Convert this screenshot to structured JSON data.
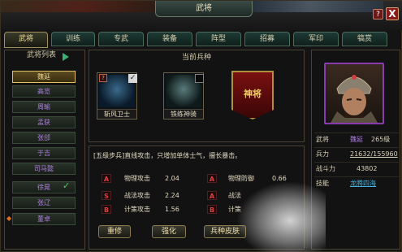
{
  "window": {
    "title": "武将",
    "help": "?",
    "close": "X"
  },
  "tabs": [
    {
      "label": "武将"
    },
    {
      "label": "训练"
    },
    {
      "label": "专武"
    },
    {
      "label": "装备"
    },
    {
      "label": "阵型"
    },
    {
      "label": "招募"
    },
    {
      "label": "军印"
    },
    {
      "label": "犒赏"
    }
  ],
  "general_list": {
    "title": "武将列表",
    "items": [
      {
        "label": "魏延"
      },
      {
        "label": "高览"
      },
      {
        "label": "周瑜"
      },
      {
        "label": "孟获"
      },
      {
        "label": "张郃"
      },
      {
        "label": "于吉"
      },
      {
        "label": "司马懿"
      },
      {
        "label": "徐晃"
      },
      {
        "label": "张辽"
      },
      {
        "label": "董卓"
      }
    ]
  },
  "troops": {
    "title": "当前兵种",
    "cards": [
      {
        "label": "斩风卫士"
      },
      {
        "label": "铁练神骑"
      }
    ],
    "banner_text": "神将"
  },
  "description": "[五级步兵]直线攻击，只增加单体士气，擅长暴击。",
  "stats": {
    "left": [
      {
        "icon": "A",
        "name": "物理攻击",
        "value": "2.04"
      },
      {
        "icon": "S",
        "name": "战法攻击",
        "value": "2.24"
      },
      {
        "icon": "B",
        "name": "计策攻击",
        "value": "1.56"
      }
    ],
    "right": [
      {
        "icon": "A",
        "name": "物理防御",
        "value": "0.66"
      },
      {
        "icon": "A",
        "name": "战法"
      },
      {
        "icon": "B",
        "name": "计策"
      }
    ]
  },
  "buttons": {
    "retrain": "重修",
    "strengthen": "强化",
    "skin": "兵种皮肤"
  },
  "info": {
    "general_key": "武将",
    "general_name": "魏延",
    "general_level": "265级",
    "troops_key": "兵力",
    "troops_val": "21632/155960",
    "power_key": "战斗力",
    "power_val": "43802",
    "skill_key": "技能",
    "skill_val": "龙腾四海"
  },
  "colors": {
    "accent_gold": "#e0c060",
    "purple_name": "#b080e0",
    "link_blue": "#40b0e0"
  }
}
